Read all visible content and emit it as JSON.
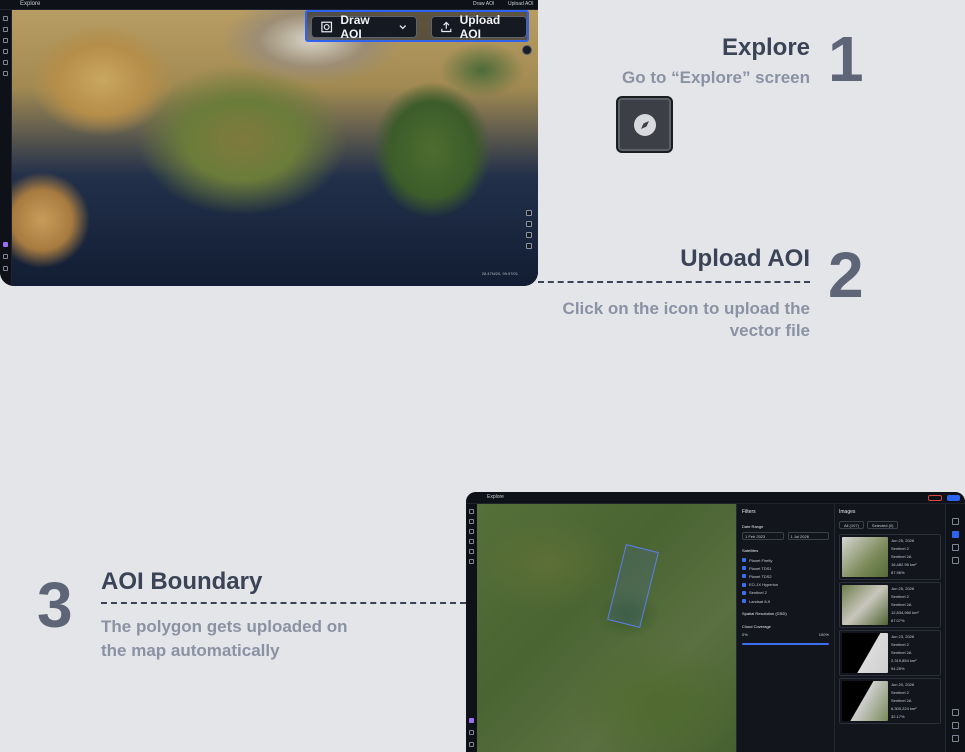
{
  "steps": [
    {
      "number": "1",
      "title": "Explore",
      "subtitle": "Go to “Explore” screen"
    },
    {
      "number": "2",
      "title": "Upload AOI",
      "subtitle_line1": "Click on the icon to upload the",
      "subtitle_line2": "vector file"
    },
    {
      "number": "3",
      "title": "AOI Boundary",
      "subtitle_line1": "The polygon gets uploaded on",
      "subtitle_line2": "the map automatically"
    }
  ],
  "shot1": {
    "app_title": "Explore",
    "mini_draw": "Draw AOI",
    "mini_upload": "Upload AOI",
    "draw_aoi_label": "Draw AOI",
    "upload_aoi_label": "Upload AOI",
    "coords": "28.47N/20, 99.97/01"
  },
  "compass_icon": "compass-icon",
  "shot3": {
    "app_title": "Explore",
    "filters": {
      "title": "Filters",
      "date_range_label": "Date Range",
      "date_from": "1 Feb 2023",
      "date_to": "1 Jul 2026",
      "satellites_label": "Satellites",
      "satellites": [
        "Planet Firefly",
        "Planet TDS1",
        "Planet TDS2",
        "EO-1X Hyperion",
        "Sentinel 2",
        "Landsat 8-9"
      ],
      "spatial_resolution_label": "Spatial Resolution (GSD)",
      "cloud_coverage_label": "Cloud Coverage",
      "cloud_min": "0%",
      "cloud_max": "100%"
    },
    "images": {
      "title": "Images",
      "tab_all": "All (107)",
      "tab_selected": "Selected (0)",
      "cards": [
        {
          "date": "Jun 25, 2026",
          "sat": "Sentinel 2",
          "band": "Sentinel 2A",
          "area": "16,482.96 km²",
          "cloud": "87.96%"
        },
        {
          "date": "Jun 25, 2026",
          "sat": "Sentinel 2",
          "band": "Sentinel 2A",
          "area": "12,834,960 km²",
          "cloud": "67.07%"
        },
        {
          "date": "Jun 23, 2026",
          "sat": "Sentinel 2",
          "band": "Sentinel 2A",
          "area": "2,319,854 km²",
          "cloud": "94.25%"
        },
        {
          "date": "Jun 20, 2026",
          "sat": "Sentinel 2",
          "band": "Sentinel 2A",
          "area": "6,300,224 km²",
          "cloud": "32.17%"
        }
      ]
    }
  }
}
